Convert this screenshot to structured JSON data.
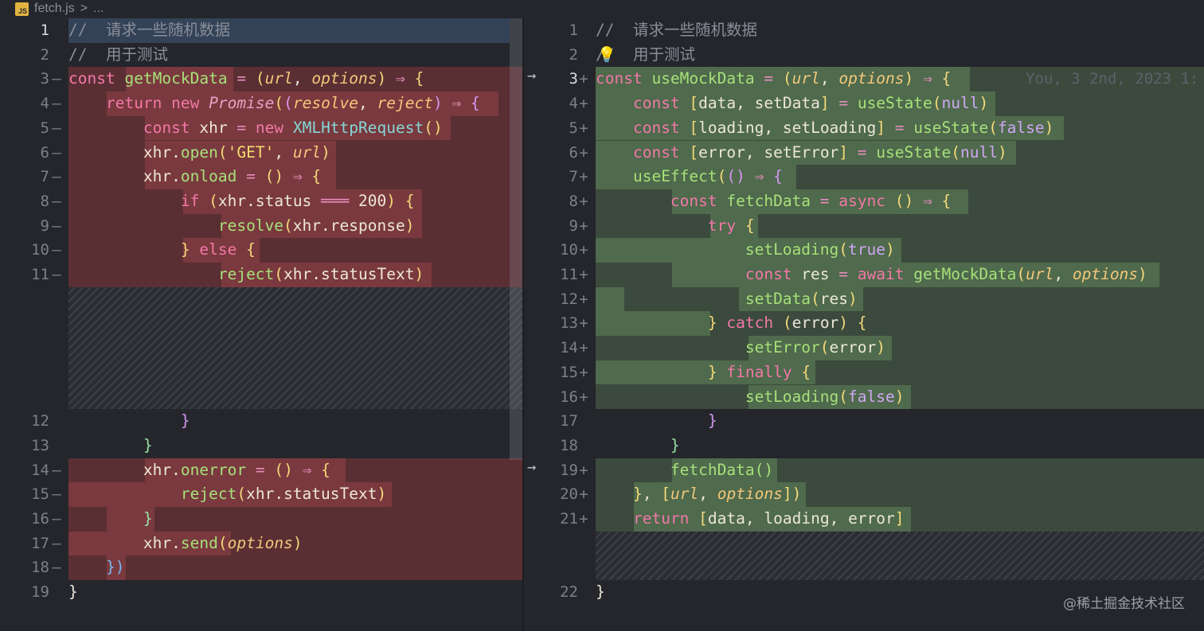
{
  "breadcrumb": {
    "file_icon": "JS",
    "file": "fetch.js",
    "separator": ">",
    "ellipsis": "..."
  },
  "left": {
    "lines": [
      {
        "n": "1",
        "m": "",
        "text": "//  请求一些随机数据"
      },
      {
        "n": "2",
        "m": "",
        "text": "//  用于测试"
      },
      {
        "n": "3",
        "m": "—",
        "text": "const getMockData = (url, options) ⇒ {"
      },
      {
        "n": "4",
        "m": "—",
        "text": "    return new Promise((resolve, reject) ⇒ {"
      },
      {
        "n": "5",
        "m": "—",
        "text": "        const xhr = new XMLHttpRequest()"
      },
      {
        "n": "6",
        "m": "—",
        "text": "        xhr.open('GET', url)"
      },
      {
        "n": "7",
        "m": "—",
        "text": "        xhr.onload = () ⇒ {"
      },
      {
        "n": "8",
        "m": "—",
        "text": "            if (xhr.status ═══ 200) {"
      },
      {
        "n": "9",
        "m": "—",
        "text": "                resolve(xhr.response)"
      },
      {
        "n": "10",
        "m": "—",
        "text": "            } else {"
      },
      {
        "n": "11",
        "m": "—",
        "text": "                reject(xhr.statusText)"
      },
      {
        "n": "12",
        "m": "",
        "text": "            }"
      },
      {
        "n": "13",
        "m": "",
        "text": "        }"
      },
      {
        "n": "14",
        "m": "—",
        "text": "        xhr.onerror = () ⇒ {"
      },
      {
        "n": "15",
        "m": "—",
        "text": "            reject(xhr.statusText)"
      },
      {
        "n": "16",
        "m": "—",
        "text": "        }"
      },
      {
        "n": "17",
        "m": "—",
        "text": "        xhr.send(options)"
      },
      {
        "n": "18",
        "m": "—",
        "text": "    })"
      },
      {
        "n": "19",
        "m": "",
        "text": "}"
      }
    ]
  },
  "right": {
    "blame": "You, 3 2nd, 2023 1:",
    "lines": [
      {
        "n": "1",
        "m": "",
        "text": "//  请求一些随机数据"
      },
      {
        "n": "2",
        "m": "",
        "text": "//  用于测试"
      },
      {
        "n": "3",
        "m": "+",
        "text": "const useMockData = (url, options) ⇒ {"
      },
      {
        "n": "4",
        "m": "+",
        "text": "    const [data, setData] = useState(null)"
      },
      {
        "n": "5",
        "m": "+",
        "text": "    const [loading, setLoading] = useState(false)"
      },
      {
        "n": "6",
        "m": "+",
        "text": "    const [error, setError] = useState(null)"
      },
      {
        "n": "7",
        "m": "+",
        "text": "    useEffect(() ⇒ {"
      },
      {
        "n": "8",
        "m": "+",
        "text": "        const fetchData = async () ⇒ {"
      },
      {
        "n": "9",
        "m": "+",
        "text": "            try {"
      },
      {
        "n": "10",
        "m": "+",
        "text": "                setLoading(true)"
      },
      {
        "n": "11",
        "m": "+",
        "text": "                const res = await getMockData(url, options)"
      },
      {
        "n": "12",
        "m": "+",
        "text": "                setData(res)"
      },
      {
        "n": "13",
        "m": "+",
        "text": "            } catch (error) {"
      },
      {
        "n": "14",
        "m": "+",
        "text": "                setError(error)"
      },
      {
        "n": "15",
        "m": "+",
        "text": "            } finally {"
      },
      {
        "n": "16",
        "m": "+",
        "text": "                setLoading(false)"
      },
      {
        "n": "17",
        "m": "",
        "text": "            }"
      },
      {
        "n": "18",
        "m": "",
        "text": "        }"
      },
      {
        "n": "19",
        "m": "+",
        "text": "        fetchData()"
      },
      {
        "n": "20",
        "m": "+",
        "text": "    }, [url, options])"
      },
      {
        "n": "21",
        "m": "+",
        "text": "    return [data, loading, error]"
      },
      {
        "n": "22",
        "m": "",
        "text": "}"
      }
    ]
  },
  "watermark": "@稀土掘金技术社区",
  "colors": {
    "background": "#24262c",
    "deleted": "#5a2f34",
    "added": "#3b4a3c",
    "keyword": "#f178a8",
    "function": "#a7e07a",
    "param": "#f2c77b",
    "comment": "#898e98"
  }
}
